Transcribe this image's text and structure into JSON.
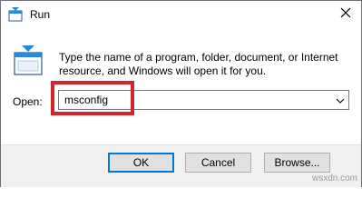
{
  "window": {
    "title": "Run"
  },
  "dialog": {
    "description": "Type the name of a program, folder, document, or Internet resource, and Windows will open it for you.",
    "open_label": "Open:",
    "open_value": "msconfig"
  },
  "buttons": {
    "ok": "OK",
    "cancel": "Cancel",
    "browse": "Browse..."
  },
  "icons": {
    "title_icon": "run-icon",
    "main_icon": "run-icon",
    "close_icon": "close-icon",
    "dropdown_icon": "chevron-down-icon"
  },
  "colors": {
    "highlight": "#d3232c",
    "ok_focus_border": "#0078d7"
  },
  "watermark": "wsxdn.com"
}
